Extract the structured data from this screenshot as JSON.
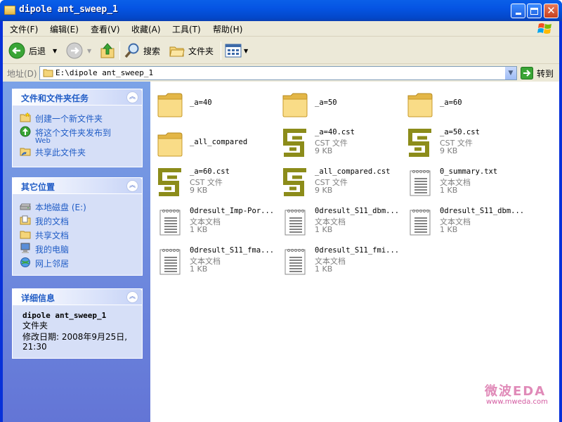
{
  "window": {
    "title": "dipole ant_sweep_1"
  },
  "menu": [
    "文件(F)",
    "编辑(E)",
    "查看(V)",
    "收藏(A)",
    "工具(T)",
    "帮助(H)"
  ],
  "toolbar": {
    "back": "后退",
    "search": "搜索",
    "folders": "文件夹"
  },
  "address": {
    "label": "地址(D)",
    "path": "E:\\dipole ant_sweep_1",
    "go": "转到"
  },
  "tasks": {
    "title": "文件和文件夹任务",
    "items": [
      {
        "label": "创建一个新文件夹",
        "icon": "new-folder-icon"
      },
      {
        "label": "将这个文件夹发布到",
        "label2": "Web",
        "icon": "publish-web-icon"
      },
      {
        "label": "共享此文件夹",
        "icon": "share-folder-icon"
      }
    ]
  },
  "places": {
    "title": "其它位置",
    "items": [
      {
        "label": "本地磁盘 (E:)",
        "icon": "hard-drive-icon"
      },
      {
        "label": "我的文档",
        "icon": "my-documents-icon"
      },
      {
        "label": "共享文档",
        "icon": "shared-documents-icon"
      },
      {
        "label": "我的电脑",
        "icon": "my-computer-icon"
      },
      {
        "label": "网上邻居",
        "icon": "network-places-icon"
      }
    ]
  },
  "details": {
    "title": "详细信息",
    "name": "dipole ant_sweep_1",
    "type": "文件夹",
    "modified": "修改日期: 2008年9月25日,",
    "modified2": "21:30"
  },
  "files": [
    {
      "name": "_a=40",
      "type": "",
      "size": "",
      "kind": "folder"
    },
    {
      "name": "_a=50",
      "type": "",
      "size": "",
      "kind": "folder"
    },
    {
      "name": "_a=60",
      "type": "",
      "size": "",
      "kind": "folder"
    },
    {
      "name": "_all_compared",
      "type": "",
      "size": "",
      "kind": "folder"
    },
    {
      "name": "_a=40.cst",
      "type": "CST 文件",
      "size": "9 KB",
      "kind": "cst"
    },
    {
      "name": "_a=50.cst",
      "type": "CST 文件",
      "size": "9 KB",
      "kind": "cst"
    },
    {
      "name": "_a=60.cst",
      "type": "CST 文件",
      "size": "9 KB",
      "kind": "cst"
    },
    {
      "name": "_all_compared.cst",
      "type": "CST 文件",
      "size": "9 KB",
      "kind": "cst"
    },
    {
      "name": "0_summary.txt",
      "type": "文本文档",
      "size": "1 KB",
      "kind": "txt"
    },
    {
      "name": "0dresult_Imp-Por...",
      "type": "文本文档",
      "size": "1 KB",
      "kind": "txt"
    },
    {
      "name": "0dresult_S11_dbm...",
      "type": "文本文档",
      "size": "1 KB",
      "kind": "txt"
    },
    {
      "name": "0dresult_S11_dbm...",
      "type": "文本文档",
      "size": "1 KB",
      "kind": "txt"
    },
    {
      "name": "0dresult_S11_fma...",
      "type": "文本文档",
      "size": "1 KB",
      "kind": "txt"
    },
    {
      "name": "0dresult_S11_fmi...",
      "type": "文本文档",
      "size": "1 KB",
      "kind": "txt"
    }
  ],
  "watermark": {
    "brand": "微波EDA",
    "url": "www.mweda.com"
  },
  "colors": {
    "titlebar": "#0554e3",
    "sidebar": "#7ba2e7",
    "link": "#215dc6",
    "cst": "#8c8c1a"
  }
}
